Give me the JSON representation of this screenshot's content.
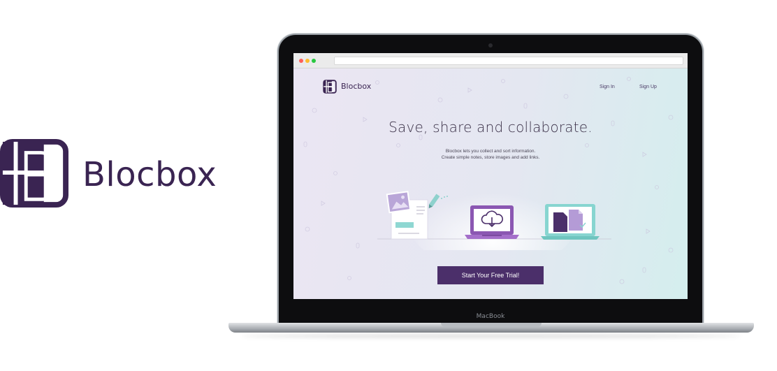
{
  "brand": {
    "name": "Blocbox",
    "color": "#3a2452"
  },
  "laptop": {
    "chin_label": "MacBook"
  },
  "browser": {
    "dots": [
      "#ff5f57",
      "#febc2e",
      "#28c840"
    ]
  },
  "site": {
    "brand": "Blocbox",
    "nav": {
      "sign_in": "Sign In",
      "sign_up": "Sign Up"
    },
    "headline": "Save, share and collaborate.",
    "subtext_line1": "Blocbox lets you collect and sort information.",
    "subtext_line2": "Create simple notes, store images and add links.",
    "cta": "Start Your Free Trial!",
    "accent": "#4b2f6a",
    "illustration": {
      "left": "notes-and-image-icon",
      "center": "cloud-upload-laptop-icon",
      "right": "documents-laptop-icon"
    }
  }
}
